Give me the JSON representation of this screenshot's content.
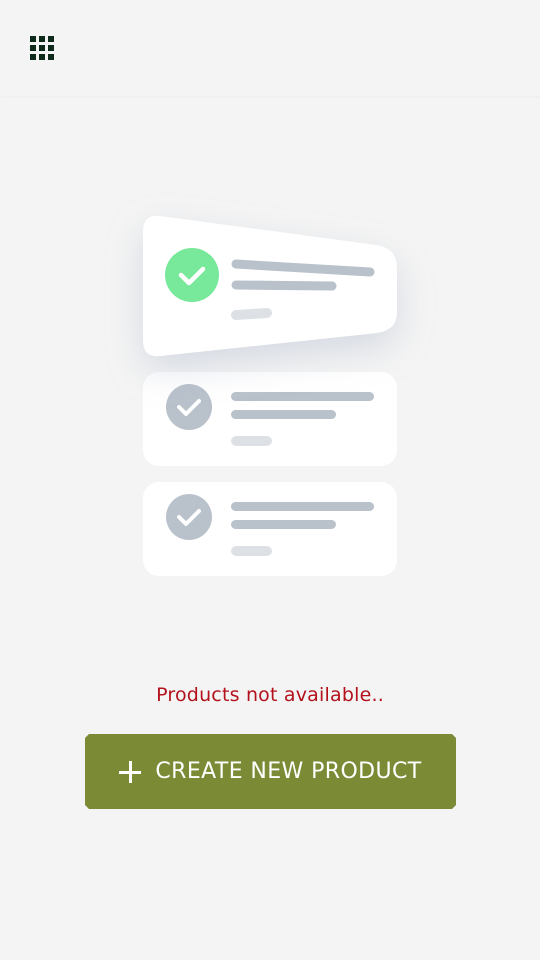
{
  "header": {
    "menu_icon": "apps-grid-icon"
  },
  "illustration": {
    "icon": "checklist-cards-illustration",
    "colors": {
      "check_active": "#78e89a",
      "check_inactive": "#b9c1cb",
      "line": "#b9c1cb",
      "line_light": "#dde1e6",
      "card": "#ffffff"
    }
  },
  "empty_state": {
    "message": "Products not available.."
  },
  "create_button": {
    "label": "CREATE NEW PRODUCT",
    "icon": "plus-icon",
    "color": "#7b8b35"
  }
}
